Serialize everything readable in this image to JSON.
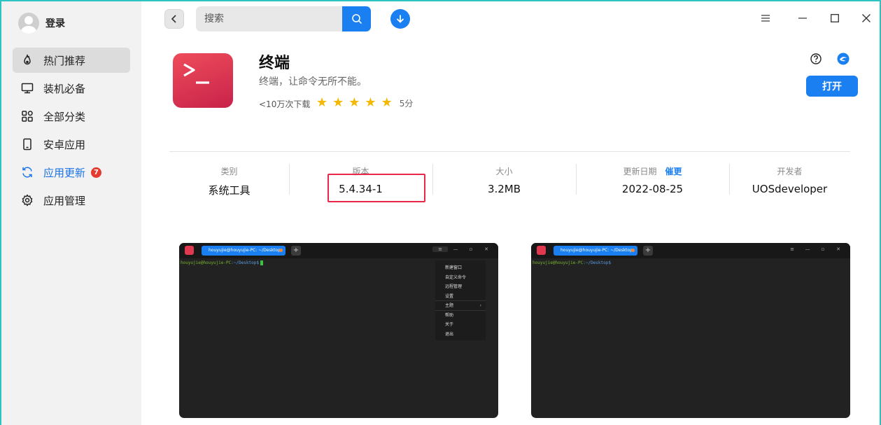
{
  "sidebar": {
    "login": "登录",
    "items": [
      {
        "label": "热门推荐",
        "icon": "fire-icon",
        "active": true
      },
      {
        "label": "装机必备",
        "icon": "monitor-icon"
      },
      {
        "label": "全部分类",
        "icon": "grid-icon"
      },
      {
        "label": "安卓应用",
        "icon": "phone-icon"
      },
      {
        "label": "应用更新",
        "icon": "refresh-icon",
        "badge": "7"
      },
      {
        "label": "应用管理",
        "icon": "gear-icon"
      }
    ]
  },
  "toolbar": {
    "search_placeholder": "搜索"
  },
  "app": {
    "name": "终端",
    "description": "终端，让命令无所不能。",
    "downloads": "<10万次下载",
    "rating": 5,
    "score": "5分",
    "open_label": "打开"
  },
  "info": {
    "category_label": "类别",
    "category_value": "系统工具",
    "version_label": "版本",
    "version_value": "5.4.34-1",
    "size_label": "大小",
    "size_value": "3.2MB",
    "date_label": "更新日期",
    "date_link": "催更",
    "date_value": "2022-08-25",
    "dev_label": "开发者",
    "dev_value": "UOSdeveloper"
  },
  "screenshots": [
    {
      "tab": "houyujie@houyujie-PC: ~/Desktop",
      "prompt_user": "houyujie@houyujie-PC",
      "prompt_path": ":~/Desktop$",
      "menu": [
        "新建窗口",
        "自定义命令",
        "远程管理",
        "设置",
        "主题",
        "帮助",
        "关于",
        "退出"
      ]
    },
    {
      "tab": "houyujie@houyujie-PC: ~/Desktop",
      "prompt_user": "houyujie@houyujie-PC",
      "prompt_path": ":~/Desktop$"
    }
  ],
  "colors": {
    "accent": "#1a7ff0",
    "badge": "#e53a2f",
    "highlight": "#e8274a",
    "star": "#f5b800"
  }
}
